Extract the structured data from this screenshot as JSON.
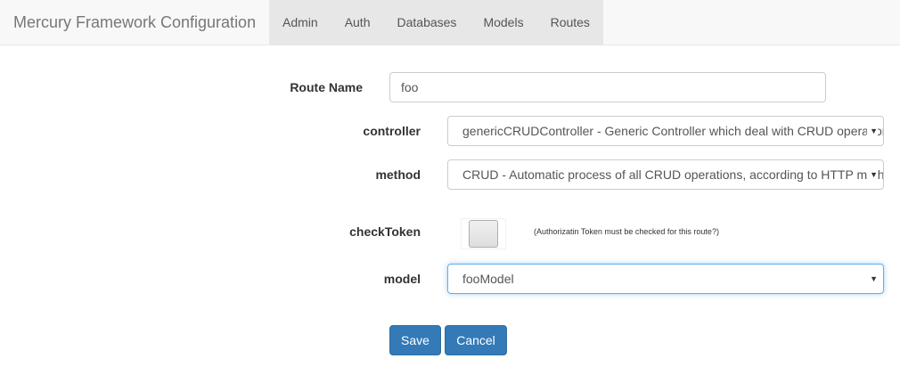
{
  "navbar": {
    "brand": "Mercury Framework Configuration",
    "tabs": [
      "Admin",
      "Auth",
      "Databases",
      "Models",
      "Routes"
    ]
  },
  "form": {
    "route_name": {
      "label": "Route Name",
      "value": "foo"
    },
    "controller": {
      "label": "controller",
      "value": "genericCRUDController - Generic Controller which deal with CRUD operations"
    },
    "method": {
      "label": "method",
      "value": "CRUD - Automatic process of all CRUD operations, according to HTTP method"
    },
    "check_token": {
      "label": "checkToken",
      "hint": "(Authorizatin Token must be checked for this route?)",
      "checked": false
    },
    "model": {
      "label": "model",
      "value": "fooModel"
    }
  },
  "buttons": {
    "save": "Save",
    "cancel": "Cancel"
  },
  "colors": {
    "primary": "#337ab7",
    "navbar_bg": "#f8f8f8",
    "focus": "#66afe9"
  }
}
